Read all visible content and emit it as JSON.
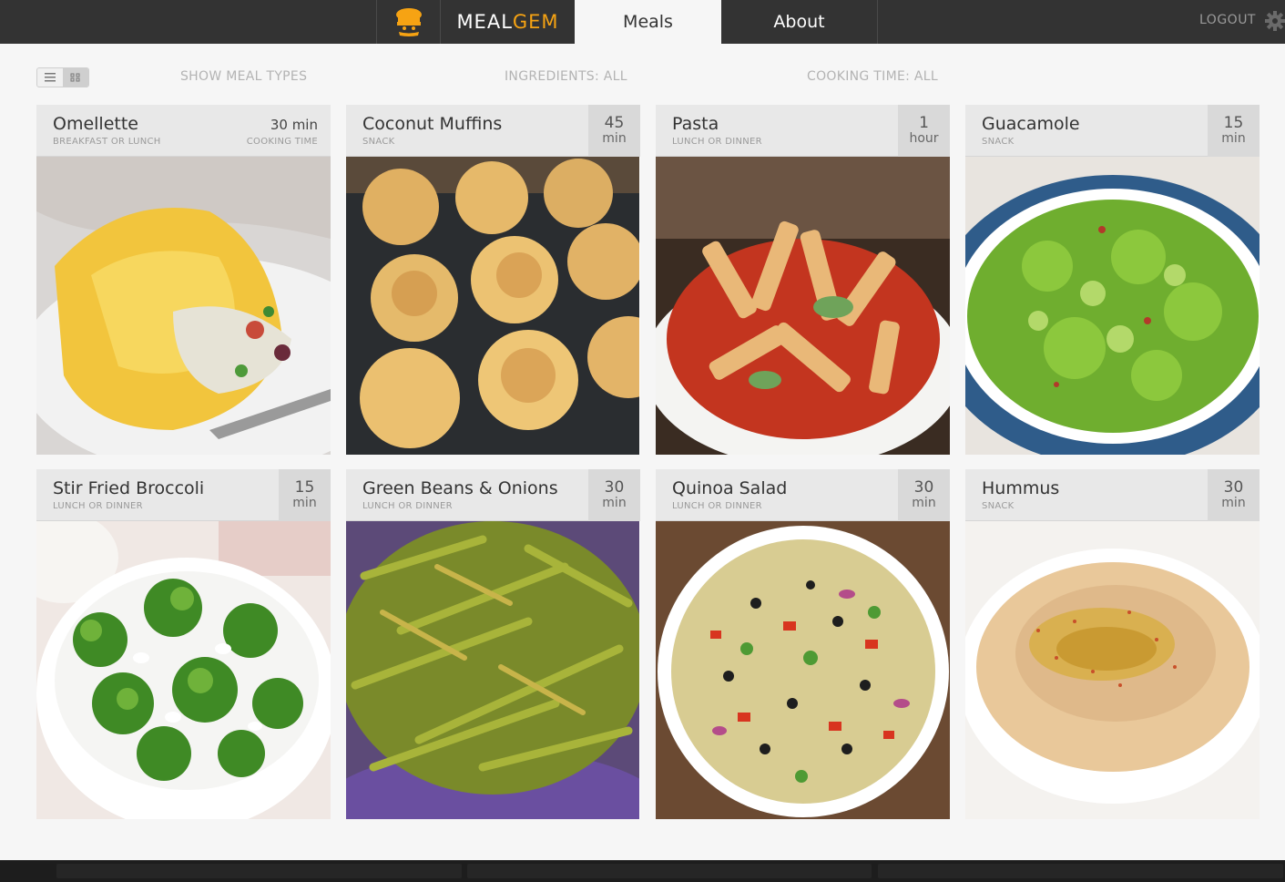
{
  "nav": {
    "brand_part1": "MEAL",
    "brand_part2": "GEM",
    "tabs": [
      {
        "label": "Meals",
        "active": true
      },
      {
        "label": "About",
        "active": false
      }
    ],
    "logout_label": "LOGOUT",
    "icons": {
      "logo": "chef-hat-icon",
      "settings": "gear-icon"
    }
  },
  "filters": {
    "view_modes": [
      {
        "name": "list-view-icon",
        "active": false
      },
      {
        "name": "grid-view-icon",
        "active": true
      }
    ],
    "meal_types": "SHOW MEAL TYPES",
    "ingredients": "INGREDIENTS: ALL",
    "cooking_time": "COOKING TIME: ALL"
  },
  "meals": [
    {
      "title": "Omellette",
      "type": "BREAKFAST OR LUNCH",
      "time_num": "30",
      "time_unit": "min",
      "time_text": "30 min",
      "time_caption": "COOKING TIME"
    },
    {
      "title": "Coconut Muffins",
      "type": "SNACK",
      "time_num": "45",
      "time_unit": "min"
    },
    {
      "title": "Pasta",
      "type": "LUNCH OR DINNER",
      "time_num": "1",
      "time_unit": "hour"
    },
    {
      "title": "Guacamole",
      "type": "SNACK",
      "time_num": "15",
      "time_unit": "min"
    },
    {
      "title": "Stir Fried Broccoli",
      "type": "LUNCH OR DINNER",
      "time_num": "15",
      "time_unit": "min"
    },
    {
      "title": "Green Beans & Onions",
      "type": "LUNCH OR DINNER",
      "time_num": "30",
      "time_unit": "min"
    },
    {
      "title": "Quinoa Salad",
      "type": "LUNCH OR DINNER",
      "time_num": "30",
      "time_unit": "min"
    },
    {
      "title": "Hummus",
      "type": "SNACK",
      "time_num": "30",
      "time_unit": "min"
    }
  ],
  "colors": {
    "nav_bg": "#333333",
    "brand_accent": "#f6a313",
    "page_bg": "#f6f6f6",
    "card_header_bg": "#e8e8e8",
    "time_box_bg": "#d9d9d9"
  }
}
